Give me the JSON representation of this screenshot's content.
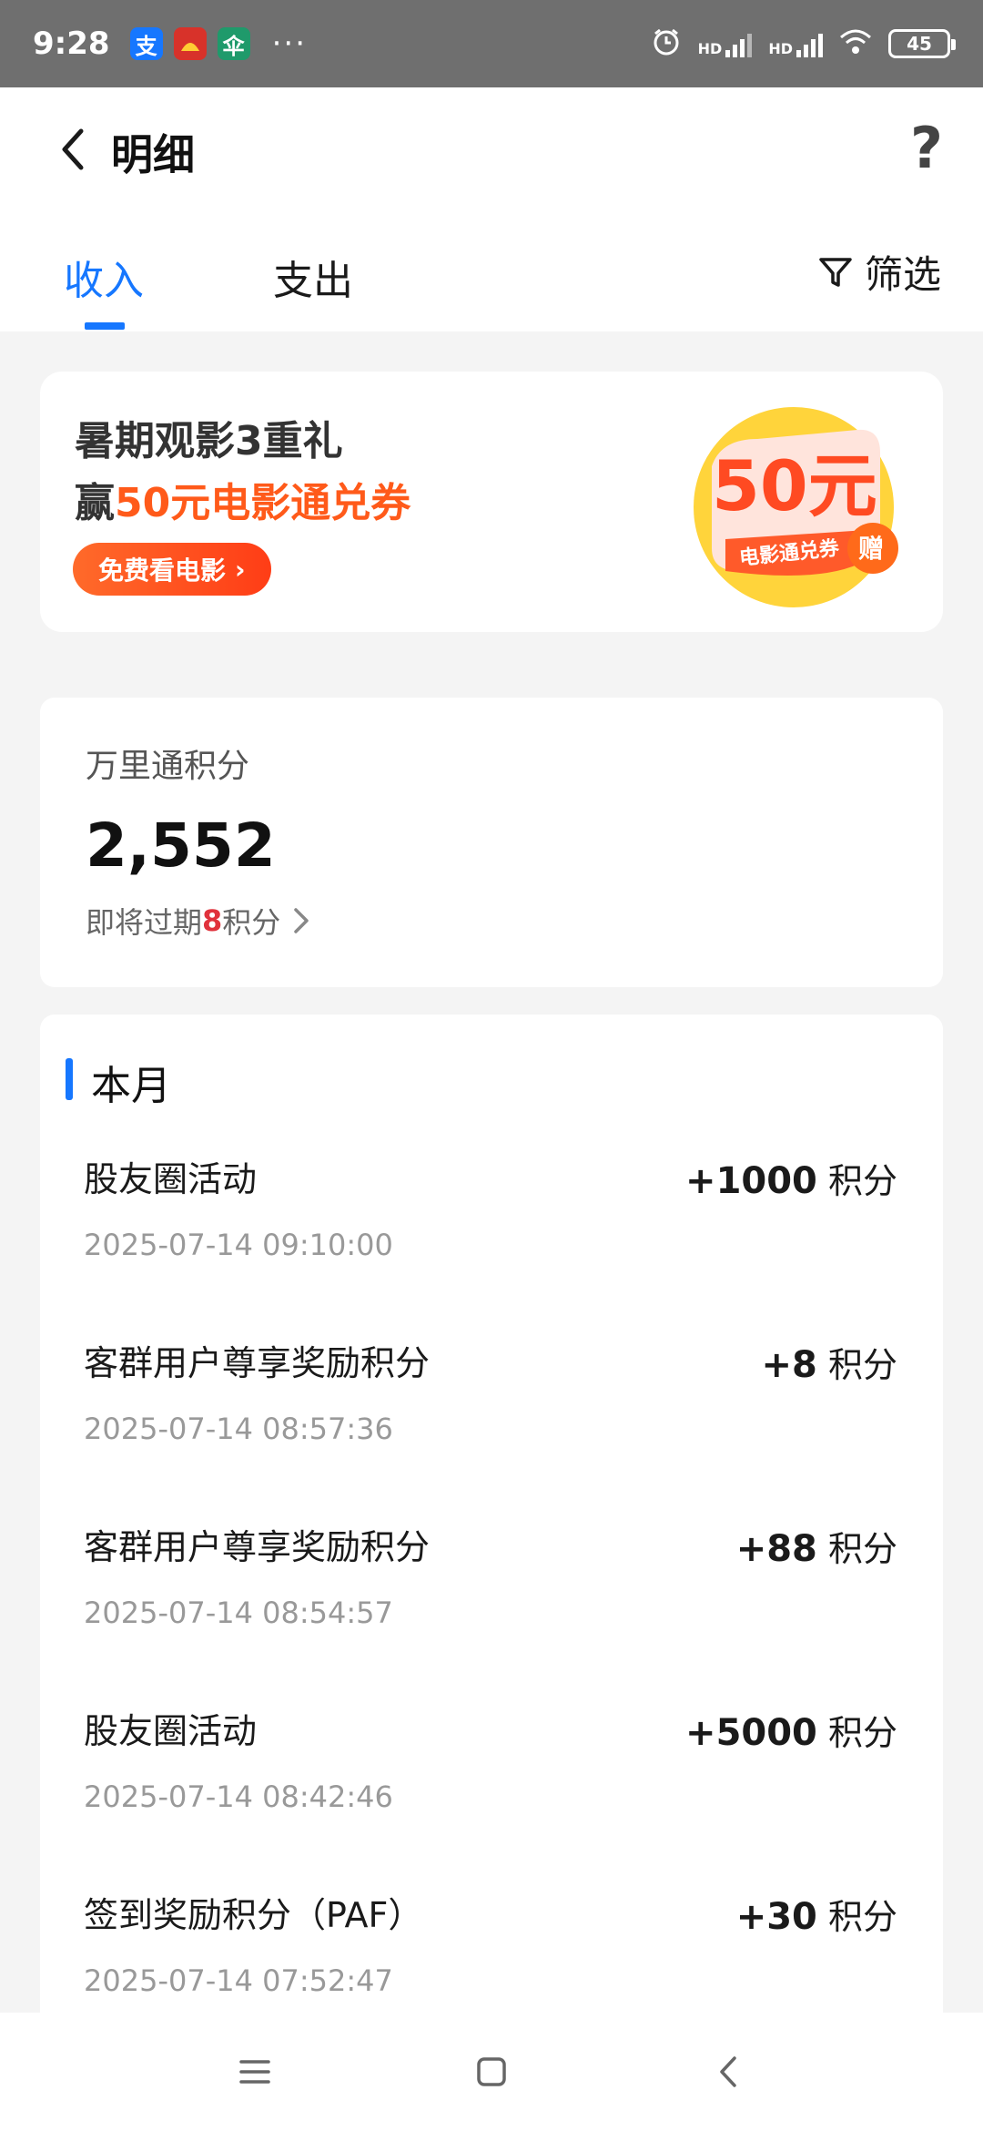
{
  "status_bar": {
    "time": "9:28",
    "apps": [
      {
        "icon": "alipay-icon",
        "glyph": "支",
        "color": "#1677ff"
      },
      {
        "icon": "bank-app-icon",
        "glyph": "",
        "color": "#d8322a"
      },
      {
        "icon": "travel-app-icon",
        "glyph": "伞",
        "color": "#1f9a6b"
      }
    ],
    "more": "···",
    "signal_1": "HD",
    "signal_2": "HD",
    "battery": "45"
  },
  "header": {
    "title": "明细",
    "help": "?"
  },
  "tabs": [
    {
      "label": "收入",
      "active": true
    },
    {
      "label": "支出",
      "active": false
    }
  ],
  "filter": {
    "label": "筛选"
  },
  "banner": {
    "line1": "暑期观影3重礼",
    "line2_prefix": "赢",
    "line2_highlight": "50元电影通兑券",
    "button": "免费看电影",
    "button_arrow": "›",
    "coupon": {
      "amount": "50元",
      "caption": "电影通兑券",
      "badge": "赠"
    }
  },
  "points": {
    "label": "万里通积分",
    "value": "2,552",
    "expire_prefix": "即将过期",
    "expire_num": "8",
    "expire_suffix": "积分"
  },
  "list": {
    "month_label": "本月",
    "items": [
      {
        "title": "股友圈活动",
        "time": "2025-07-14 09:10:00",
        "amount": "+1000",
        "unit": "积分"
      },
      {
        "title": "客群用户尊享奖励积分",
        "time": "2025-07-14 08:57:36",
        "amount": "+8",
        "unit": "积分"
      },
      {
        "title": "客群用户尊享奖励积分",
        "time": "2025-07-14 08:54:57",
        "amount": "+88",
        "unit": "积分"
      },
      {
        "title": "股友圈活动",
        "time": "2025-07-14 08:42:46",
        "amount": "+5000",
        "unit": "积分"
      },
      {
        "title": "签到奖励积分（PAF）",
        "time": "2025-07-14 07:52:47",
        "amount": "+30",
        "unit": "积分"
      }
    ]
  },
  "nav": {
    "icons": [
      "menu-icon",
      "home-icon",
      "back-icon"
    ]
  }
}
